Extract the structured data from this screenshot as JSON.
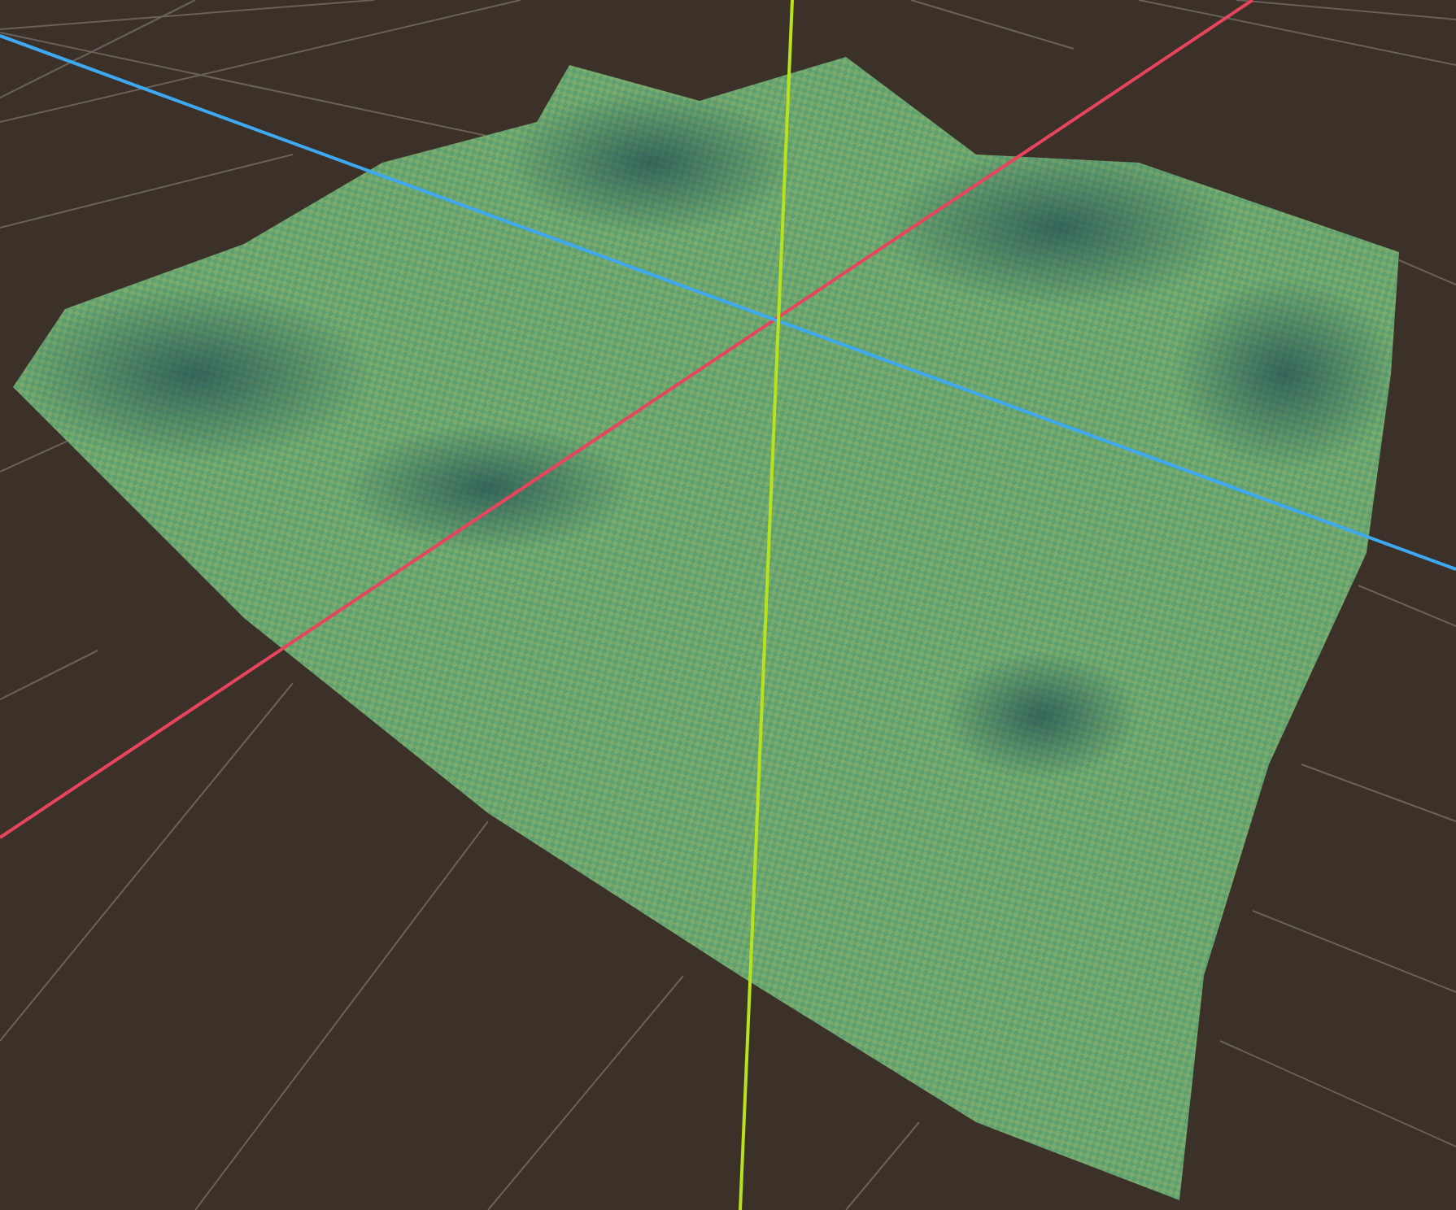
{
  "viewport": {
    "kind": "perspective"
  },
  "axes": [
    {
      "kind": "x",
      "color": "#e8445e"
    },
    {
      "kind": "z",
      "color": "#3ea8f0"
    },
    {
      "kind": "y",
      "color": "#b8e21a"
    }
  ]
}
